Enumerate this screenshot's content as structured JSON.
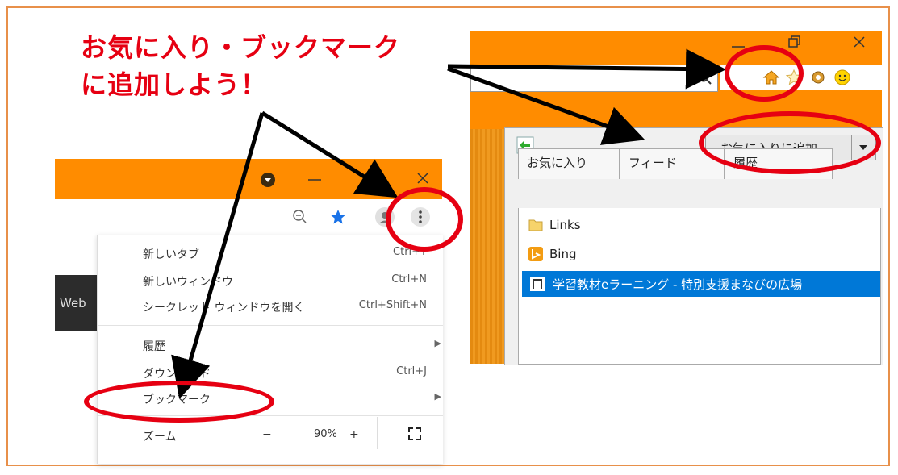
{
  "headline": {
    "line1": "お気に入り・ブックマーク",
    "line2": "に追加しよう！"
  },
  "chrome": {
    "web_strip_text": "Web",
    "menu_items": [
      {
        "label": "新しいタブ",
        "shortcut": "Ctrl+T"
      },
      {
        "label": "新しいウィンドウ",
        "shortcut": "Ctrl+N"
      },
      {
        "label": "シークレット ウィンドウを開く",
        "shortcut": "Ctrl+Shift+N"
      },
      {
        "label": "履歴",
        "shortcut": ""
      },
      {
        "label": "ダウンロード",
        "shortcut": "Ctrl+J"
      },
      {
        "label": "ブックマーク",
        "shortcut": ""
      },
      {
        "label": "ズーム",
        "shortcut": ""
      }
    ],
    "zoom": {
      "minus": "−",
      "value": "90%",
      "plus": "+"
    }
  },
  "ie": {
    "add_favorites_label": "お気に入りに追加",
    "tabs": [
      "お気に入り",
      "フィード",
      "履歴"
    ],
    "list_items": [
      {
        "label": "Links",
        "icon": "folder-icon"
      },
      {
        "label": "Bing",
        "icon": "bing-icon"
      },
      {
        "label": "学習教材eラーニング - 特別支援まなびの広場",
        "icon": "site-icon"
      }
    ]
  },
  "colors": {
    "accent_orange": "#ff8c00",
    "highlight_red": "#e60012",
    "selection_blue": "#0078d7"
  }
}
